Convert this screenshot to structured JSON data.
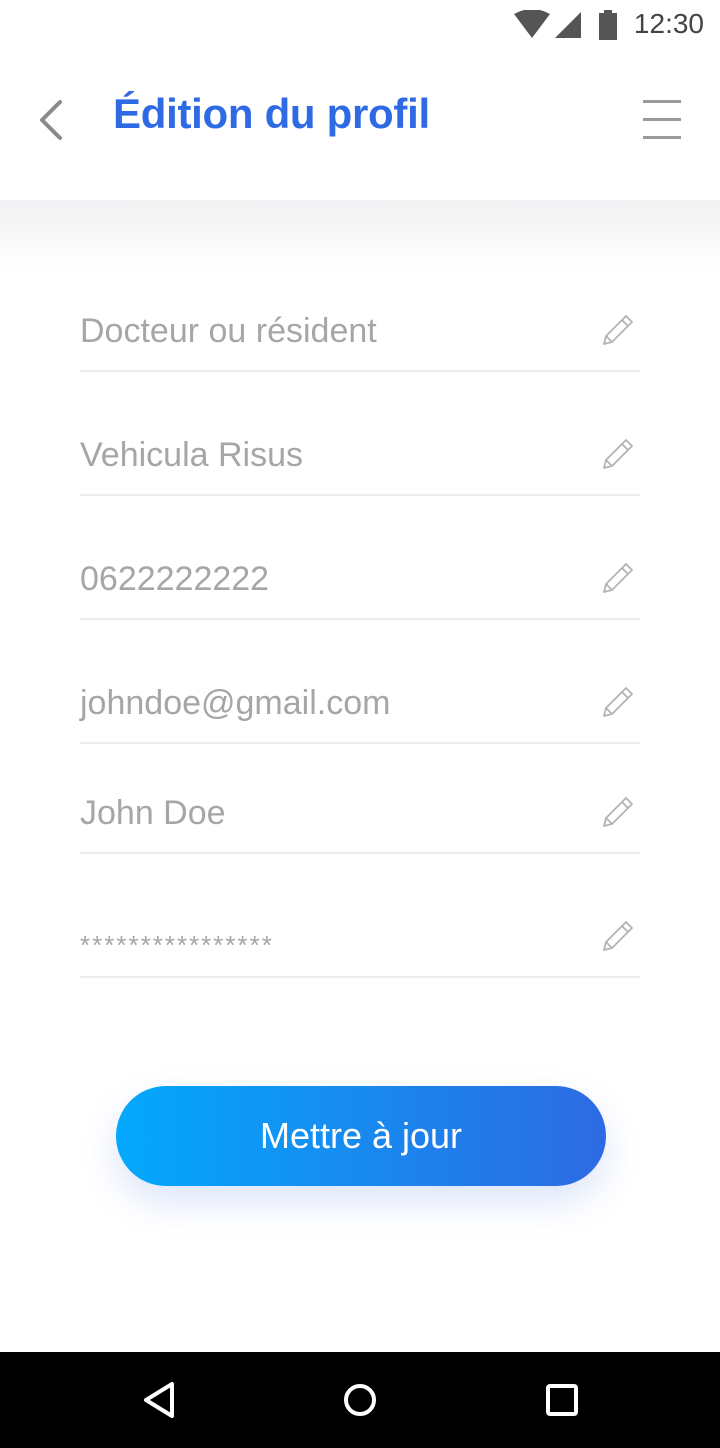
{
  "status_bar": {
    "time": "12:30",
    "icons": [
      "wifi-icon",
      "cellular-icon",
      "battery-icon"
    ]
  },
  "header": {
    "title": "Édition du profil",
    "back_icon": "chevron-left-icon",
    "menu_icon": "hamburger-menu-icon"
  },
  "form": {
    "fields": [
      {
        "name": "role",
        "value": "Docteur ou résident",
        "icon": "pencil-icon"
      },
      {
        "name": "address",
        "value": "Vehicula Risus",
        "icon": "pencil-icon"
      },
      {
        "name": "phone",
        "value": "0622222222",
        "icon": "pencil-icon"
      },
      {
        "name": "email",
        "value": "johndoe@gmail.com",
        "icon": "pencil-icon"
      },
      {
        "name": "full-name",
        "value": "John Doe",
        "icon": "pencil-icon"
      },
      {
        "name": "password",
        "value": "****************",
        "icon": "pencil-icon"
      }
    ],
    "submit_label": "Mettre à jour"
  },
  "nav_bar": {
    "icons": [
      "back-triangle-icon",
      "home-circle-icon",
      "recents-square-icon"
    ]
  },
  "colors": {
    "accent": "#2d6ae3",
    "gradient_start": "#03a9fc",
    "gradient_end": "#2d6ae3",
    "field_text": "#a6a6a6"
  }
}
